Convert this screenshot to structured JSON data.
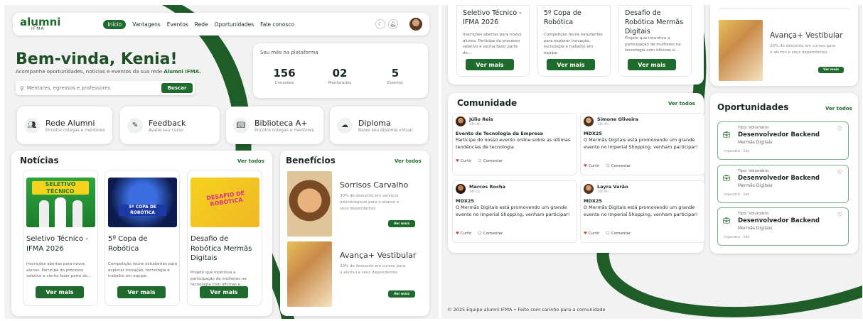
{
  "left": {
    "brand": {
      "name": "alumni",
      "sub": "IFMA"
    },
    "nav": [
      "Início",
      "Vantagens",
      "Eventos",
      "Rede",
      "Oportunidades",
      "Fale conosco"
    ],
    "hero": {
      "greeting": "Bem-vinda, Kenia!",
      "subtitle": "Acompanhe oportunidades, notícias e eventos da sua rede",
      "subtitle_brand": "Alumni IFMA."
    },
    "search": {
      "placeholder": "Mentores, egressos e professores",
      "button": "Buscar"
    },
    "stats": {
      "title": "Seu mês na plataforma",
      "items": [
        {
          "value": "156",
          "label": "Conexões"
        },
        {
          "value": "02",
          "label": "Mentorados"
        },
        {
          "value": "5",
          "label": "Eventos"
        }
      ]
    },
    "quick": [
      {
        "title": "Rede Alumni",
        "desc": "Encotre colegas e mentores",
        "icon": "people-icon"
      },
      {
        "title": "Feedback",
        "desc": "Avalie seu curso",
        "icon": "feedback-icon"
      },
      {
        "title": "Biblioteca A+",
        "desc": "Encotre colegas e mentores",
        "icon": "book-icon"
      },
      {
        "title": "Diploma",
        "desc": "Baixe seu diploma virtual",
        "icon": "cloud-download-icon"
      }
    ],
    "news": {
      "title": "Notícias",
      "see_all": "Ver todos",
      "items": [
        {
          "title": "Seletivo Técnico - IFMA 2026",
          "desc": "Inscrições abertas para novos alunos. Participe do processo seletivo e venha fazer parte do...",
          "cta": "Ver mais"
        },
        {
          "title": "5º Copa de Robótica",
          "desc": "Competição reúne estudantes para explorar inovação, tecnologia e trabalho em equipe.",
          "cta": "Ver mais"
        },
        {
          "title": "Desafio de Robótica Mermãs Digitais",
          "desc": "Projeto que incentiva a participação de mulheres na tecnologia com oficinas e...",
          "cta": "Ver mais"
        }
      ]
    },
    "news_images": {
      "img1": "SELETIVO TÉCNICO",
      "img2": "5º COPA DE ROBÓTICA",
      "img3": "DESAFIO DE ROBÓTICA"
    },
    "benefits": {
      "title": "Benefícios",
      "see_all": "Ver todos",
      "items": [
        {
          "title": "Sorrisos Carvalho",
          "desc": "30% de desconto em serviços odontológicos para o alumni e seus dependentes",
          "cta": "Ver mais"
        },
        {
          "title": "Avança+ Vestibular",
          "desc": "20% de desconto em cursos para o alumni e seus dependentes",
          "cta": "Ver mais"
        }
      ]
    }
  },
  "right": {
    "news_top": [
      {
        "title": "Seletivo Técnico - IFMA 2026",
        "desc": "Inscrições abertas para novos alunos. Participe do processo seletivo e venha fazer parte do...",
        "cta": "Ver mais"
      },
      {
        "title": "5º Copa de Robótica",
        "desc": "Competição reúne estudantes para explorar inovação, tecnologia e trabalho em equipe.",
        "cta": "Ver mais"
      },
      {
        "title": "Desafio de Robótica Mermãs Digitais",
        "desc": "Projeto que incentiva a participação de mulheres na tecnologia com oficinas e...",
        "cta": "Ver mais"
      }
    ],
    "benefit_top": {
      "title": "Avança+ Vestibular",
      "desc": "20% de desconto em cursos para o alumni e seus dependentes",
      "cta": "Ver mais"
    },
    "community": {
      "title": "Comunidade",
      "see_all": "Ver todos",
      "posts": [
        {
          "name": "Júlio Reis",
          "time": "14h 4h",
          "headline": "Evento de Tecnologia da Empresa",
          "text": "Participe do nosso evento online sobre as últimas tendências de tecnologia",
          "like": "Curtir",
          "comment": "Comentar"
        },
        {
          "name": "Simone Oliveira",
          "time": "14h 4h",
          "headline": "MDX25",
          "text": "O Mermãs Digitais está promovendo um grande evento no Imperial Shopping, venham participar!",
          "like": "Curtir",
          "comment": "Comentar"
        },
        {
          "name": "Marcos Rocha",
          "time": "14h 02",
          "headline": "MDX25",
          "text": "O Mermãs Digitais está promovendo um grande evento no Imperial Shopping, venham participar!",
          "like": "Curtir",
          "comment": "Comentar"
        },
        {
          "name": "Layra Varão",
          "time": "14h 4h",
          "headline": "MDX25",
          "text": "O Mermãs Digitais está promovendo um grande evento no Imperial Shopping, venham participar!",
          "like": "Curtir",
          "comment": "Comentar"
        }
      ]
    },
    "opportunities": {
      "title": "Oportunidades",
      "see_all": "Ver todos",
      "items": [
        {
          "type": "Tipo: Voluntário",
          "title": "Desenvolvedor Backend",
          "org": "Mermãs Digitais",
          "expires": "Imperatriz · 1dd"
        },
        {
          "type": "Tipo: Voluntário",
          "title": "Desenvolvedor Backend",
          "org": "Mermãs Digitais",
          "expires": "Imperatriz · 1dd"
        },
        {
          "type": "Tipo: Voluntário",
          "title": "Desenvolvedor Backend",
          "org": "Mermãs Digitais",
          "expires": "Imperatriz · 1dd"
        }
      ]
    },
    "footer": "© 2025 Equipe alumni IFMA • Feito com carinho para a comunidade"
  },
  "colors": {
    "brand_green": "#1f6b2e",
    "bg": "#f1f2f1",
    "like_red": "#d23b3b"
  }
}
